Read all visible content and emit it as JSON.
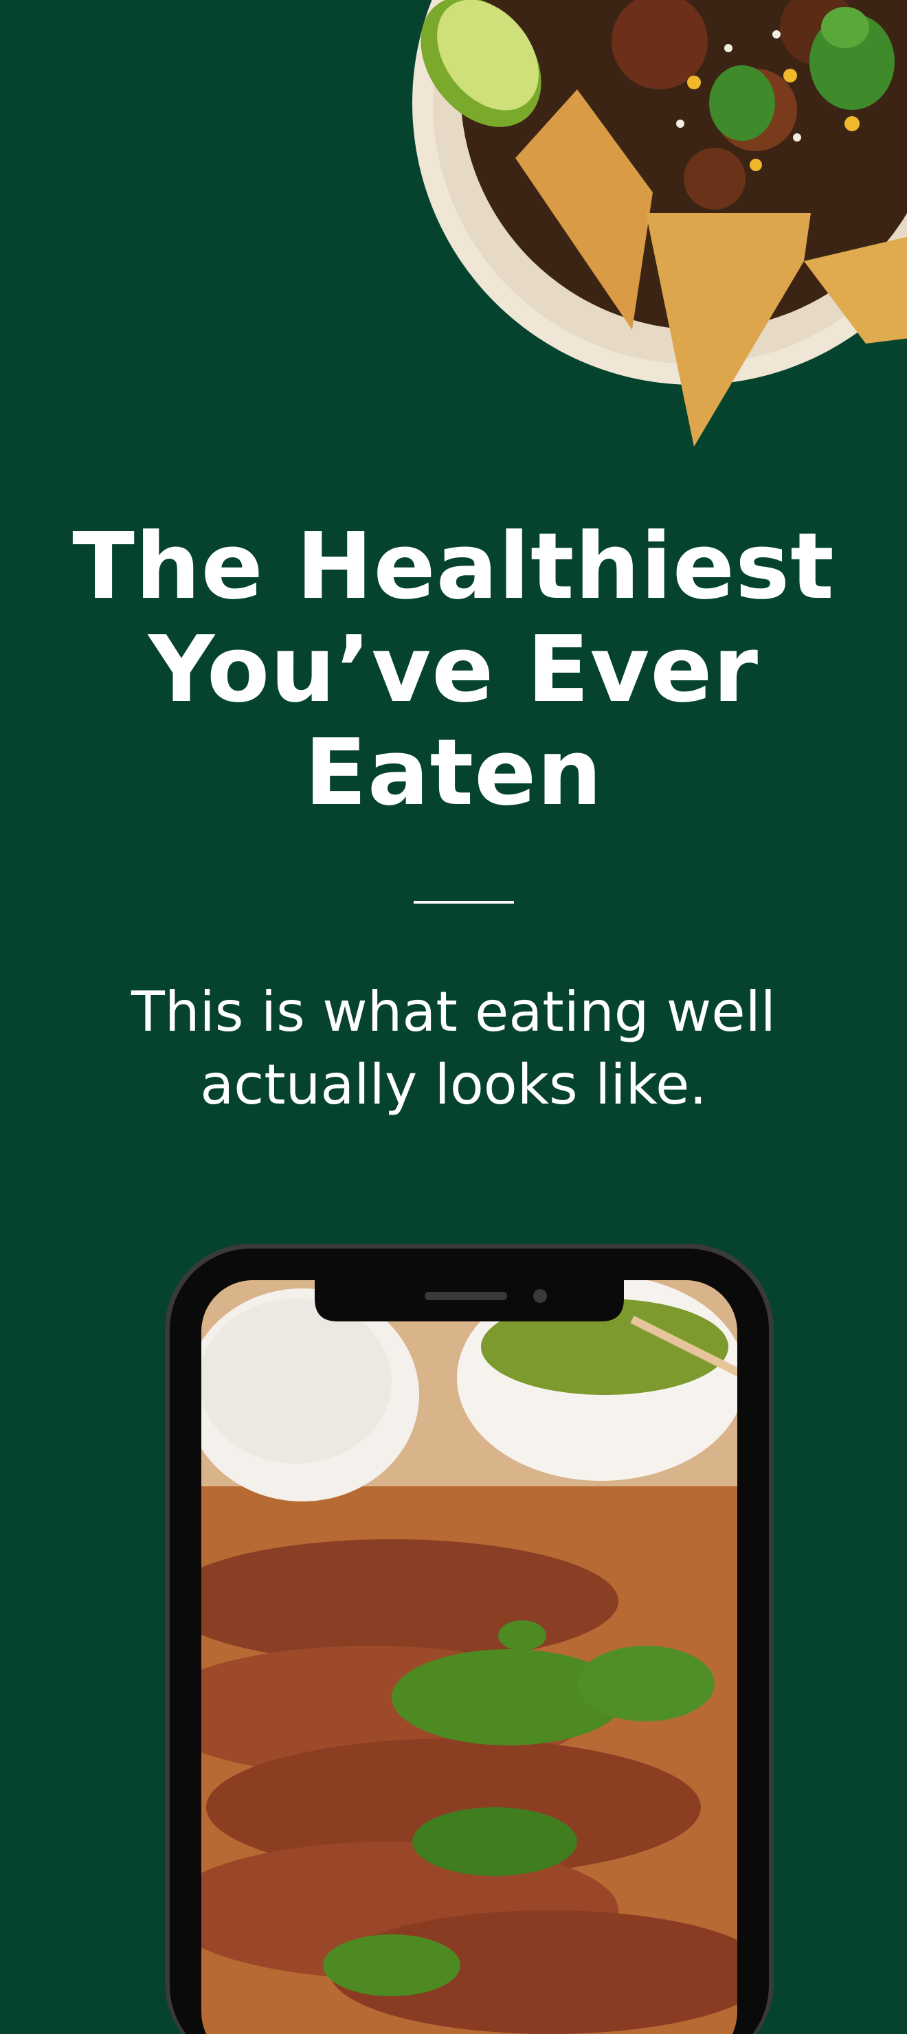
{
  "hero": {
    "image_alt": "Bowl of black bean chili with lime wedge, cilantro and tortilla chips",
    "headline_lines": [
      "The Healthiest",
      "You’ve Ever",
      "Eaten"
    ],
    "subhead_lines": [
      "This is what eating well",
      "actually looks like."
    ]
  },
  "phone_mockup": {
    "screen_image_alt": "Sliced grilled steak topped with chimichurri sauce"
  },
  "colors": {
    "background": "#05432f",
    "text": "#ffffff",
    "accent_green": "#4d8a22"
  }
}
